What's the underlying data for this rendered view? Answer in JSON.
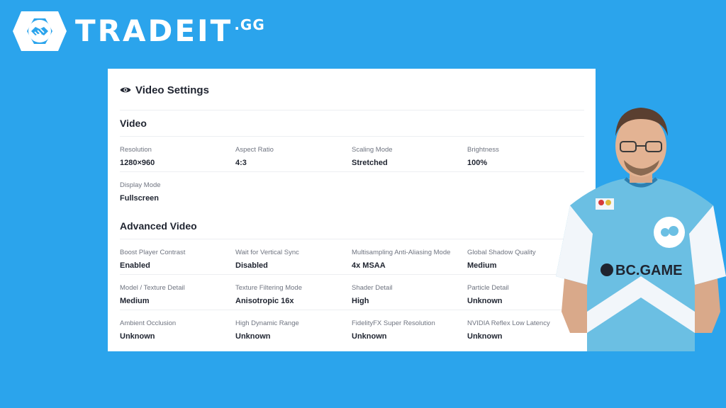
{
  "brand": {
    "wordmark": "TRADEIT",
    "tld": ".GG",
    "colors": {
      "background": "#2ba4ec",
      "card": "#ffffff",
      "text": "#1f2430",
      "muted": "#6f7480"
    }
  },
  "panel": {
    "icon": "eye-icon",
    "title": "Video Settings",
    "sections": [
      {
        "title": "Video",
        "rows": [
          [
            {
              "label": "Resolution",
              "value": "1280×960"
            },
            {
              "label": "Aspect Ratio",
              "value": "4:3"
            },
            {
              "label": "Scaling Mode",
              "value": "Stretched"
            },
            {
              "label": "Brightness",
              "value": "100%"
            }
          ],
          [
            {
              "label": "Display Mode",
              "value": "Fullscreen"
            }
          ]
        ]
      },
      {
        "title": "Advanced Video",
        "rows": [
          [
            {
              "label": "Boost Player Contrast",
              "value": "Enabled"
            },
            {
              "label": "Wait for Vertical Sync",
              "value": "Disabled"
            },
            {
              "label": "Multisampling Anti-Aliasing Mode",
              "value": "4x MSAA"
            },
            {
              "label": "Global Shadow Quality",
              "value": "Medium"
            }
          ],
          [
            {
              "label": "Model / Texture Detail",
              "value": "Medium"
            },
            {
              "label": "Texture Filtering Mode",
              "value": "Anisotropic 16x"
            },
            {
              "label": "Shader Detail",
              "value": "High"
            },
            {
              "label": "Particle Detail",
              "value": "Unknown"
            }
          ],
          [
            {
              "label": "Ambient Occlusion",
              "value": "Unknown"
            },
            {
              "label": "High Dynamic Range",
              "value": "Unknown"
            },
            {
              "label": "FidelityFX Super Resolution",
              "value": "Unknown"
            },
            {
              "label": "NVIDIA Reflex Low Latency",
              "value": "Unknown"
            }
          ]
        ]
      }
    ]
  },
  "player": {
    "jersey_text": "BC.GAME"
  }
}
